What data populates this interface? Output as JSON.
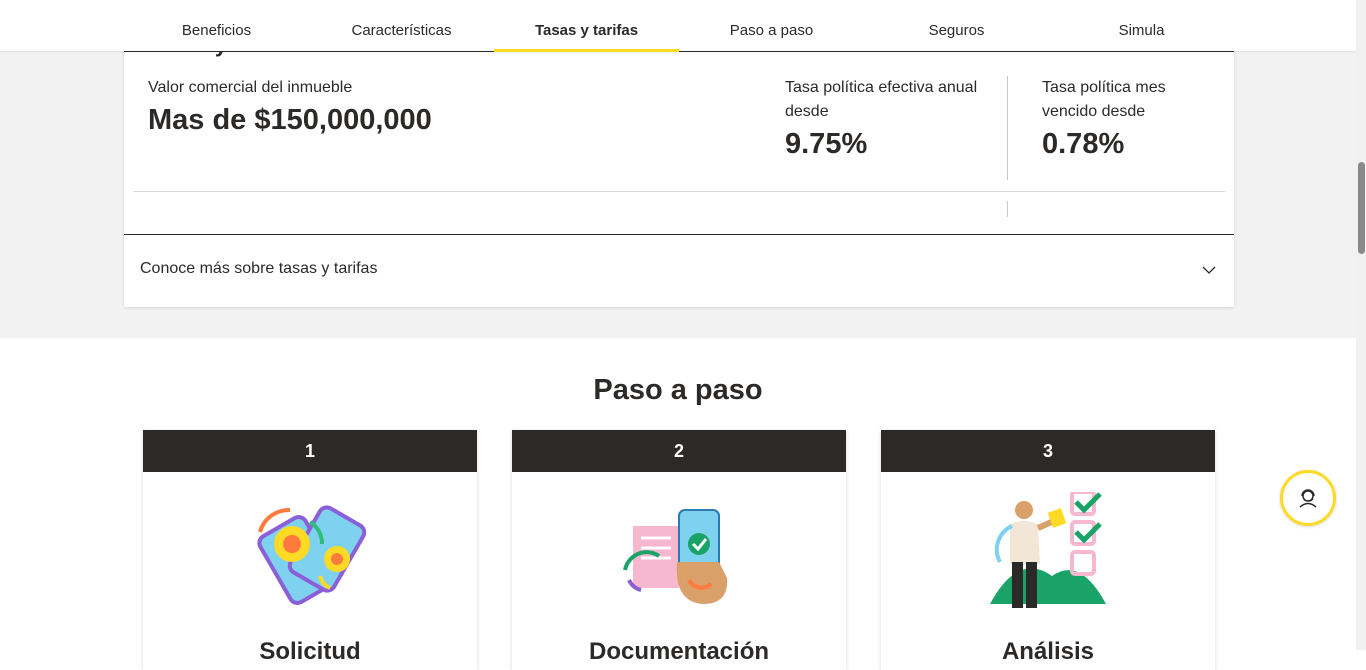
{
  "nav": {
    "tabs": [
      {
        "label": "Beneficios"
      },
      {
        "label": "Características"
      },
      {
        "label": "Tasas y tarifas"
      },
      {
        "label": "Paso a paso"
      },
      {
        "label": "Seguros"
      },
      {
        "label": "Simula"
      }
    ],
    "active_index": 2
  },
  "rates": {
    "section_title": "Tasas y tarifas",
    "property_value_label": "Valor comercial del inmueble",
    "property_value": "Mas de $150,000,000",
    "annual_rate_label": "Tasa política efectiva anual desde",
    "annual_rate": "9.75%",
    "monthly_rate_label": "Tasa política mes vencido desde",
    "monthly_rate": "0.78%",
    "accordion_label": "Conoce más sobre tasas y tarifas"
  },
  "steps": {
    "title": "Paso a paso",
    "items": [
      {
        "number": "1",
        "name": "Solicitud",
        "icon": "phone-swipe-illustration"
      },
      {
        "number": "2",
        "name": "Documentación",
        "icon": "hand-phone-check-illustration"
      },
      {
        "number": "3",
        "name": "Análisis",
        "icon": "person-checklist-illustration"
      }
    ]
  },
  "colors": {
    "accent": "#fdda24",
    "dark": "#2c2a29",
    "band": "#f2f2f2"
  },
  "help_button": {
    "icon": "support-agent-icon"
  }
}
